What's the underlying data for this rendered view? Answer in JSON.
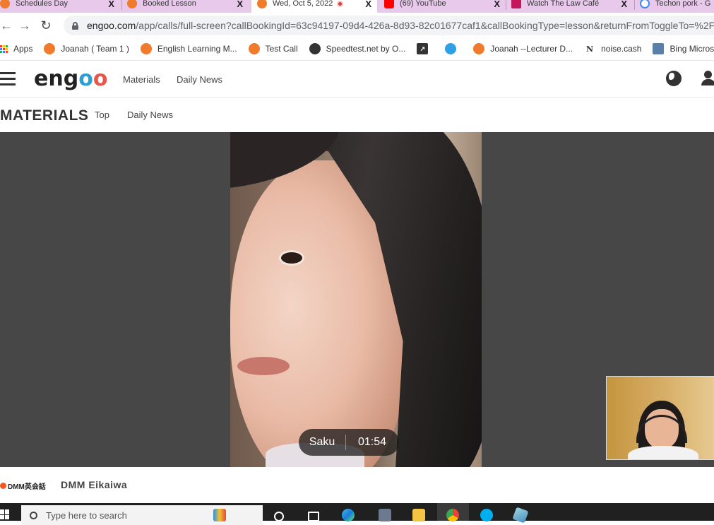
{
  "tabs": [
    {
      "title": "Schedules Day",
      "favicon": "engoo-favicon",
      "close": "X"
    },
    {
      "title": "Booked Lesson",
      "favicon": "engoo-favicon",
      "close": "X"
    },
    {
      "title": "Wed, Oct 5, 2022",
      "favicon": "engoo-favicon",
      "close": "X",
      "active": true,
      "recording": true
    },
    {
      "title": "(69) YouTube",
      "favicon": "youtube-favicon",
      "close": "X"
    },
    {
      "title": "Watch The Law Café",
      "favicon": "drama-favicon",
      "close": "X"
    },
    {
      "title": "Techon pork - G",
      "favicon": "google-favicon"
    }
  ],
  "address_bar": {
    "host": "engoo.com",
    "path": "/app/calls/full-screen?callBookingId=63c94197-09d4-426a-8d93-82c01677caf1&callBookingType=lesson&returnFromToggleTo=%2F"
  },
  "bookmarks": [
    {
      "label": "Apps",
      "icon": "apps-grid-icon"
    },
    {
      "label": "Joanah ( Team 1 )",
      "icon": "engoo-favicon"
    },
    {
      "label": "English Learning M...",
      "icon": "engoo-favicon"
    },
    {
      "label": "Test Call",
      "icon": "engoo-favicon"
    },
    {
      "label": "Speedtest.net by O...",
      "icon": "speedtest-icon"
    },
    {
      "label": "",
      "icon": "arrow-box-icon"
    },
    {
      "label": "",
      "icon": "refresh-blue-icon"
    },
    {
      "label": "Joanah --Lecturer D...",
      "icon": "engoo-favicon"
    },
    {
      "label": "noise.cash",
      "icon": "noise-cash-icon"
    },
    {
      "label": "Bing Microsoft Tra",
      "icon": "bing-translator-icon"
    }
  ],
  "engoo": {
    "logo": {
      "e": "eng",
      "o1": "o",
      "o2": "o"
    },
    "nav": [
      "Materials",
      "Daily News"
    ],
    "section_title": "MATERIALS",
    "section_links": [
      "Top",
      "Daily News"
    ]
  },
  "call": {
    "participant_name": "Saku",
    "elapsed": "01:54"
  },
  "footer": {
    "brand_logo_text": "DMM英会話",
    "brand_name": "DMM Eikaiwa"
  },
  "taskbar": {
    "search_placeholder": "Type here to search"
  },
  "colors": {
    "tab_strip": "#e8c9ec",
    "stage_bg": "#474747",
    "engoo_blue": "#2a9fd8",
    "engoo_red": "#e4574a",
    "taskbar": "#202020"
  }
}
